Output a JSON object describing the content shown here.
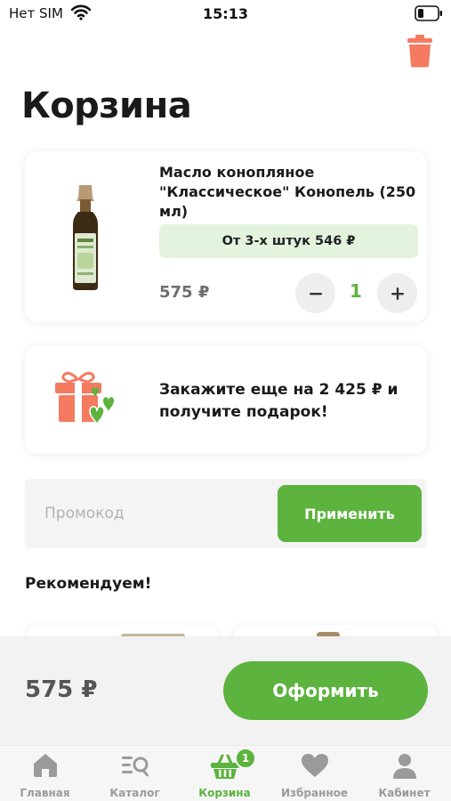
{
  "status_bar": {
    "carrier": "Нет SIM",
    "time": "15:13"
  },
  "header": {
    "title": "Корзина",
    "delete_icon": "trash-icon"
  },
  "cart_item": {
    "name": "Масло конопляное \"Классическое\" Конопель (250 мл)",
    "bulk_offer": "От 3-х штук 546 ₽",
    "price": "575 ₽",
    "quantity": "1"
  },
  "gift_promo": {
    "text": "Закажите еще на 2 425 ₽ и получите подарок!",
    "icon": "gift-icon"
  },
  "promo_code": {
    "placeholder": "Промокод",
    "value": "",
    "apply_label": "Применить"
  },
  "recommendations": {
    "title": "Рекомендуем!"
  },
  "checkout": {
    "total": "575 ₽",
    "button_label": "Оформить"
  },
  "tab_bar": {
    "items": [
      {
        "label": "Главная",
        "icon": "home-icon",
        "active": false
      },
      {
        "label": "Каталог",
        "icon": "catalog-search-icon",
        "active": false
      },
      {
        "label": "Корзина",
        "icon": "basket-icon",
        "active": true
      },
      {
        "label": "Избранное",
        "icon": "heart-icon",
        "active": false
      },
      {
        "label": "Кабинет",
        "icon": "user-icon",
        "active": false
      }
    ],
    "cart_badge": "1"
  },
  "colors": {
    "accent": "#5cb33d",
    "delete_icon": "#f47a60",
    "bulk_badge_bg": "#e4f3de",
    "inactive_tab": "#9a9a9a"
  }
}
